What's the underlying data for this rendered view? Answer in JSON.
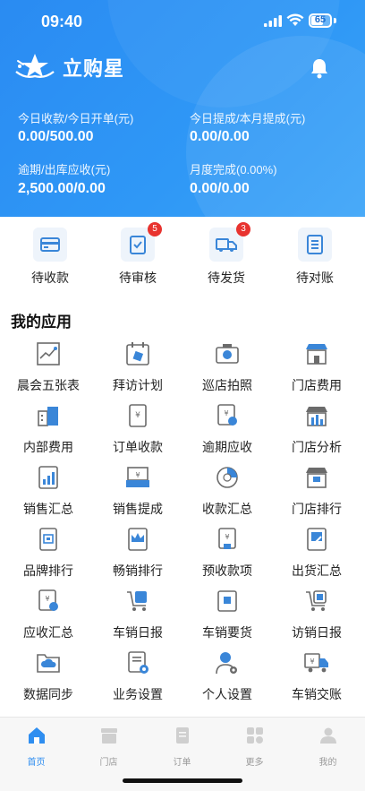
{
  "status_bar": {
    "time": "09:40",
    "battery": "65"
  },
  "header": {
    "app_name": "立购星",
    "stats": [
      {
        "label": "今日收款/今日开单(元)",
        "value": "0.00/500.00"
      },
      {
        "label": "今日提成/本月提成(元)",
        "value": "0.00/0.00"
      },
      {
        "label": "逾期/出库应收(元)",
        "value": "2,500.00/0.00"
      },
      {
        "label": "月度完成(0.00%)",
        "value": "0.00/0.00"
      }
    ]
  },
  "quick_actions": [
    {
      "label": "待收款",
      "icon": "card-icon",
      "badge": ""
    },
    {
      "label": "待审核",
      "icon": "clipboard-check-icon",
      "badge": "5"
    },
    {
      "label": "待发货",
      "icon": "truck-icon",
      "badge": "3"
    },
    {
      "label": "待对账",
      "icon": "ledger-icon",
      "badge": ""
    }
  ],
  "apps_title": "我的应用",
  "apps": [
    {
      "label": "晨会五张表",
      "icon": "trend-chart-icon"
    },
    {
      "label": "拜访计划",
      "icon": "calendar-icon"
    },
    {
      "label": "巡店拍照",
      "icon": "camera-icon"
    },
    {
      "label": "门店费用",
      "icon": "store-icon"
    },
    {
      "label": "内部费用",
      "icon": "building-icon"
    },
    {
      "label": "订单收款",
      "icon": "receipt-icon"
    },
    {
      "label": "逾期应收",
      "icon": "overdue-icon"
    },
    {
      "label": "门店分析",
      "icon": "store-analysis-icon"
    },
    {
      "label": "销售汇总",
      "icon": "bar-report-icon"
    },
    {
      "label": "销售提成",
      "icon": "drawer-icon"
    },
    {
      "label": "收款汇总",
      "icon": "pie-icon"
    },
    {
      "label": "门店排行",
      "icon": "store-rank-icon"
    },
    {
      "label": "品牌排行",
      "icon": "brand-icon"
    },
    {
      "label": "畅销排行",
      "icon": "crown-icon"
    },
    {
      "label": "预收款项",
      "icon": "advance-icon"
    },
    {
      "label": "出货汇总",
      "icon": "edit-doc-icon"
    },
    {
      "label": "应收汇总",
      "icon": "receivable-icon"
    },
    {
      "label": "车销日报",
      "icon": "cart-report-icon"
    },
    {
      "label": "车销要货",
      "icon": "box-icon"
    },
    {
      "label": "访销日报",
      "icon": "cart-doc-icon"
    },
    {
      "label": "数据同步",
      "icon": "cloud-folder-icon"
    },
    {
      "label": "业务设置",
      "icon": "doc-gear-icon"
    },
    {
      "label": "个人设置",
      "icon": "user-gear-icon"
    },
    {
      "label": "车销交账",
      "icon": "truck-money-icon"
    }
  ],
  "tabbar": [
    {
      "label": "首页",
      "icon": "home-icon",
      "active": true
    },
    {
      "label": "门店",
      "icon": "store-tab-icon",
      "active": false
    },
    {
      "label": "订单",
      "icon": "order-icon",
      "active": false
    },
    {
      "label": "更多",
      "icon": "grid-icon",
      "active": false
    },
    {
      "label": "我的",
      "icon": "profile-icon",
      "active": false
    }
  ],
  "colors": {
    "primary": "#2f8ef0",
    "badge": "#e8332f",
    "icon_blue": "#3a86d8"
  }
}
